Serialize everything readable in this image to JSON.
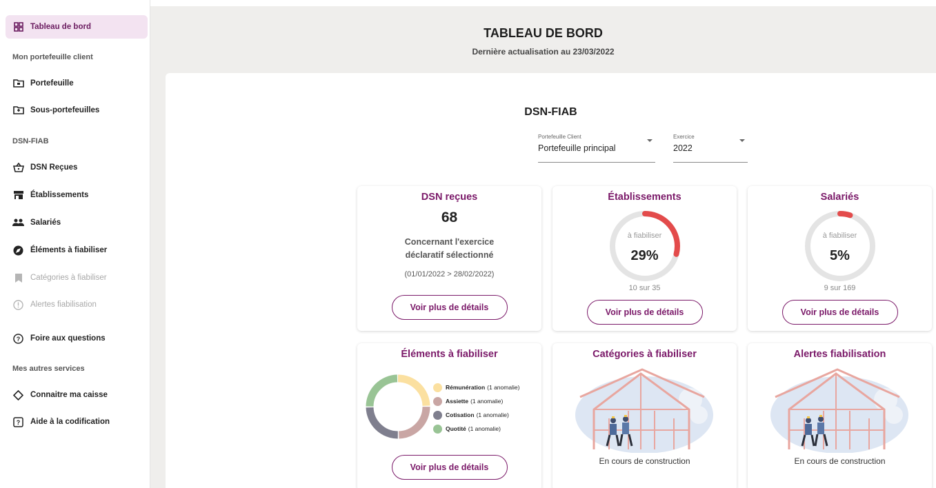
{
  "sidebar": {
    "active_item": "Tableau de bord",
    "sections": {
      "portfolio": "Mon portefeuille client",
      "dsn": "DSN-FIAB",
      "services": "Mes autres services"
    },
    "items": {
      "portefeuille": "Portefeuille",
      "sous_portefeuilles": "Sous-portefeuilles",
      "dsn_recues": "DSN Reçues",
      "etablissements": "Établissements",
      "salaries": "Salariés",
      "elements": "Éléments à fiabiliser",
      "categories": "Catégories à fiabiliser",
      "alertes": "Alertes fiabilisation",
      "faq": "Foire aux questions",
      "caisse": "Connaitre ma caisse",
      "codification": "Aide à la codification"
    }
  },
  "header": {
    "title": "TABLEAU DE BORD",
    "subtitle": "Dernière actualisation au 23/03/2022"
  },
  "main": {
    "section_title": "DSN-FIAB",
    "filters": {
      "portfolio": {
        "label": "Portefeuille Client",
        "value": "Portefeuille principal"
      },
      "exercise": {
        "label": "Exercice",
        "value": "2022"
      }
    },
    "details_button": "Voir plus de détails",
    "cards": {
      "dsn": {
        "title": "DSN reçues",
        "count": "68",
        "description_line1": "Concernant l'exercice",
        "description_line2": "déclaratif sélectionné",
        "period": "(01/01/2022 > 28/02/2022)"
      },
      "etablissements": {
        "title": "Établissements",
        "gauge_label": "à fiabiliser",
        "percent_text": "29%",
        "percent": 29,
        "ratio": "10 sur 35"
      },
      "salaries": {
        "title": "Salariés",
        "gauge_label": "à fiabiliser",
        "percent_text": "5%",
        "percent": 5,
        "ratio": "9 sur 169"
      },
      "elements": {
        "title": "Éléments à fiabiliser",
        "legend": [
          {
            "name": "Rémunération",
            "detail": "(1 anomalie)",
            "color": "#fbe0a0",
            "value": 1
          },
          {
            "name": "Assiette",
            "detail": "(1 anomalie)",
            "color": "#c9a6a4",
            "value": 1
          },
          {
            "name": "Cotisation",
            "detail": "(1 anomalie)",
            "color": "#7f7f8e",
            "value": 1
          },
          {
            "name": "Quotité",
            "detail": "(1 anomalie)",
            "color": "#99c495",
            "value": 1
          }
        ]
      },
      "categories": {
        "title": "Catégories à fiabiliser",
        "status": "En cours de construction"
      },
      "alertes": {
        "title": "Alertes fiabilisation",
        "status": "En cours de construction"
      }
    }
  },
  "colors": {
    "accent": "#7a1868",
    "gauge_fill": "#e34b4b",
    "gauge_track": "#e4e4e4",
    "active_bg": "#f3e3f1"
  }
}
